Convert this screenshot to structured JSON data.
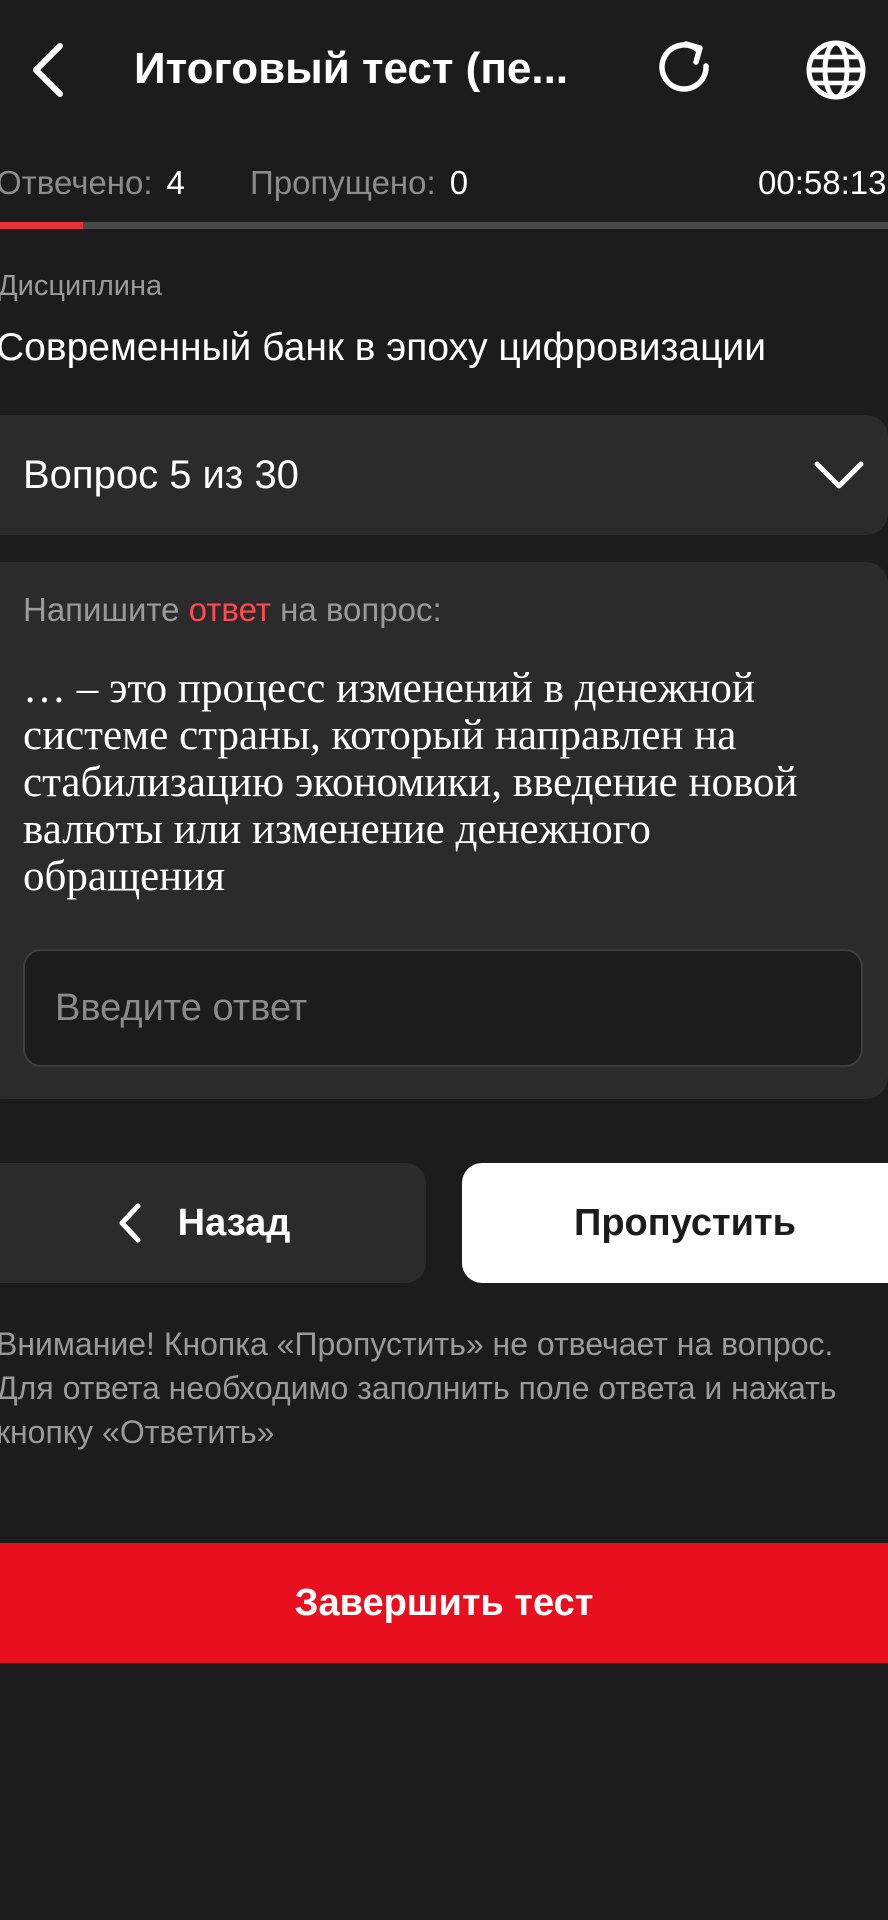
{
  "header": {
    "title": "Итоговый тест (пе...",
    "back_icon": "chevron-left-icon",
    "reload_icon": "reload-icon",
    "language_icon": "globe-icon"
  },
  "stats": {
    "answered_label": "Отвечено:",
    "answered_value": "4",
    "skipped_label": "Пропущено:",
    "skipped_value": "0",
    "timer": "00:58:13"
  },
  "progress": {
    "fraction": 0.0933
  },
  "discipline": {
    "caption": "Дисциплина",
    "name": "Современный банк в эпоху цифровизации"
  },
  "question_selector": {
    "label": "Вопрос 5 из 30",
    "icon": "chevron-down-icon"
  },
  "question": {
    "instruction_prefix": "Напишите",
    "instruction_accent": "ответ",
    "instruction_suffix": "на вопрос:",
    "text": "… – это процесс изменений в денежной системе страны, который направлен на стабилизацию экономики, введение новой валюты или изменение денежного обращения",
    "answer_placeholder": "Введите ответ",
    "answer_value": ""
  },
  "nav": {
    "back_label": "Назад",
    "skip_label": "Пропустить"
  },
  "warning": "Внимание! Кнопка «Пропустить» не отвечает на вопрос. Для ответа необходимо заполнить поле ответа и нажать кнопку «Ответить»",
  "finish_label": "Завершить тест",
  "colors": {
    "background": "#1c1c1c",
    "surface": "#2b2b2b",
    "accent_red": "#e8101f",
    "progress_red": "#e8323a",
    "highlight_red": "#ff4a52"
  }
}
